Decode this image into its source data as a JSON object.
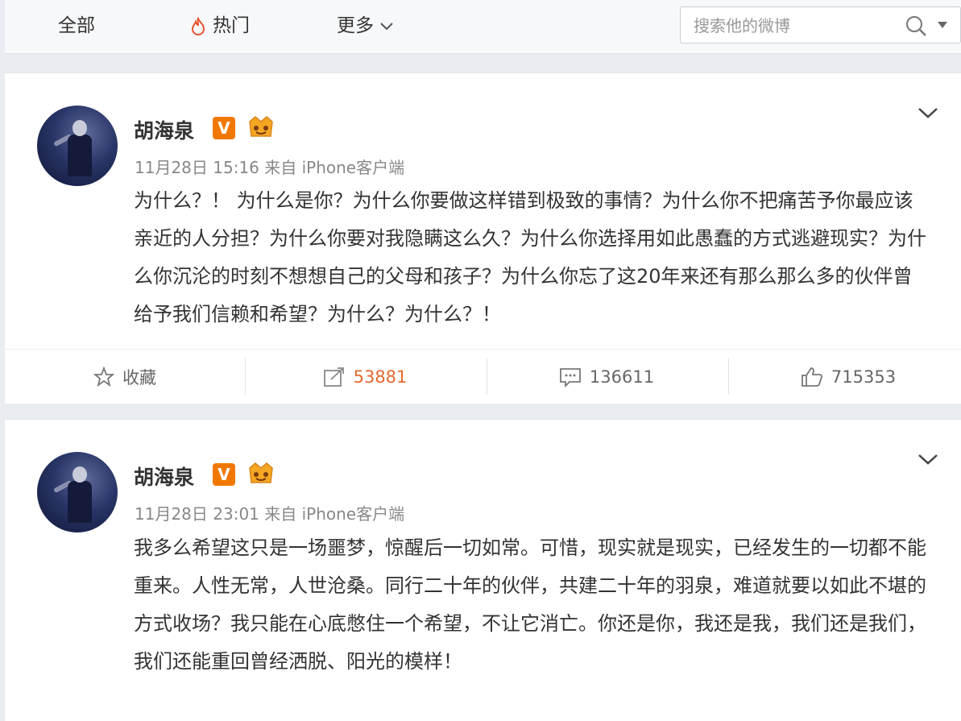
{
  "nav": {
    "all": "全部",
    "hot": "热门",
    "more": "更多"
  },
  "search": {
    "placeholder": "搜索他的微博"
  },
  "posts": [
    {
      "author": "胡海泉",
      "badge": "V",
      "meta": "11月28日 15:16 来自 iPhone客户端",
      "text": "为什么？！ 为什么是你？为什么你要做这样错到极致的事情？为什么你不把痛苦予你最应该亲近的人分担？为什么你要对我隐瞒这么久？为什么你选择用如此愚蠢的方式逃避现实？为什么你沉沦的时刻不想想自己的父母和孩子？为什么你忘了这20年来还有那么那么多的伙伴曾给予我们信赖和希望？为什么？为什么？！",
      "actions": {
        "favorite": "收藏",
        "repost": "53881",
        "comment": "136611",
        "like": "715353"
      }
    },
    {
      "author": "胡海泉",
      "badge": "V",
      "meta": "11月28日 23:01 来自 iPhone客户端",
      "text": "我多么希望这只是一场噩梦，惊醒后一切如常。可惜，现实就是现实，已经发生的一切都不能重来。人性无常，人世沧桑。同行二十年的伙伴，共建二十年的羽泉，难道就要以如此不堪的方式收场？我只能在心底憋住一个希望，不让它消亡。你还是你，我还是我，我们还是我们，我们还能重回曾经洒脱、阳光的模样！"
    }
  ],
  "colors": {
    "background": "#e9edf1",
    "verified_badge": "#f07800",
    "repost_accent": "#e46a2e",
    "hot_icon": "#e8542e"
  }
}
